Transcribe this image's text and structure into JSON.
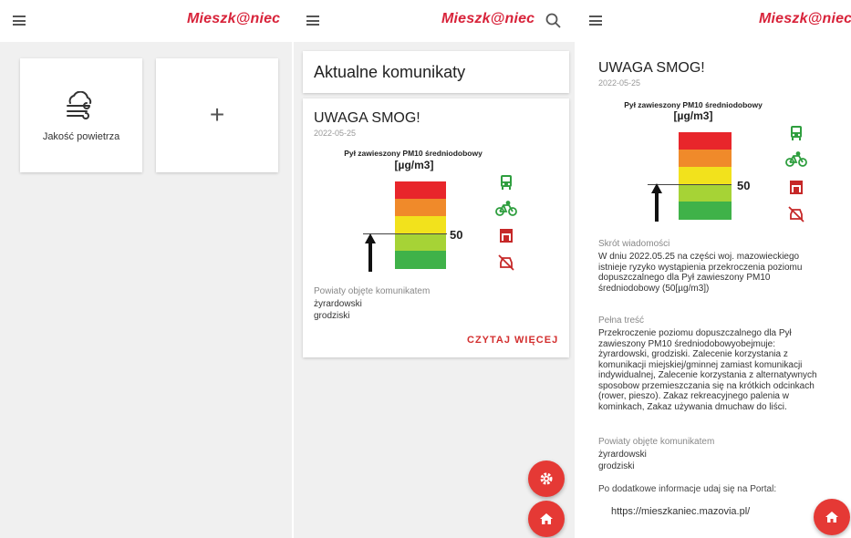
{
  "app": {
    "logo": "Mieszk@niec"
  },
  "home": {
    "tiles": [
      {
        "label": "Jakość powietrza",
        "icon": "cloud-wind-icon"
      },
      {
        "label": "+",
        "icon": "plus-icon"
      }
    ]
  },
  "announcements": {
    "header": "Aktualne komunikaty",
    "card": {
      "title": "UWAGA SMOG!",
      "date": "2022-05-25",
      "chart_title": "Pył zawieszony PM10 średniodobowy",
      "chart_unit": "[µg/m3]",
      "level_value": "50",
      "districts_label": "Powiaty objęte komunikatem",
      "districts": [
        "żyrardowski",
        "grodziski"
      ],
      "read_more": "CZYTAJ WIĘCEJ"
    }
  },
  "detail": {
    "title": "UWAGA SMOG!",
    "date": "2022-05-25",
    "chart_title": "Pył zawieszony PM10 średniodobowy",
    "chart_unit": "[µg/m3]",
    "level_value": "50",
    "summary_label": "Skrót wiadomości",
    "summary_lines": [
      "W dniu 2022.05.25 na części woj. mazowieckiego",
      "istnieje ryzyko wystąpienia przekroczenia poziomu",
      "dopuszczalnego dla Pył zawieszony PM10",
      "średniodobowy (50[µg/m3])"
    ],
    "full_label": "Pełna treść",
    "full_lines": [
      "Przekroczenie poziomu dopuszczalnego dla Pył",
      "zawieszony PM10 średniodobowyobejmuje:",
      "żyrardowski, grodziski. Zalecenie korzystania z",
      "komunikacji miejskiej/gminnej zamiast komunikacji",
      "indywidualnej, Zalecenie korzystania z alternatywnych",
      "sposobow przemieszczania się na krótkich odcinkach",
      "(rower, pieszo). Zakaz rekreacyjnego palenia w",
      "kominkach, Zakaz używania dmuchaw do liści."
    ],
    "districts_label": "Powiaty objęte komunikatem",
    "districts": [
      "żyrardowski",
      "grodziski"
    ],
    "portal_label": "Po dodatkowe informacje udaj się na Portal:",
    "portal_url": "https://mieszkaniec.mazovia.pl/"
  },
  "colors": {
    "brand": "#d8233a",
    "level_red": "#e8262b",
    "level_orange": "#f08a2a",
    "level_yellow": "#f2e21c",
    "level_lime": "#a6d336",
    "level_green": "#3fb249",
    "icon_green": "#2e9e3e",
    "icon_red": "#c62828"
  }
}
